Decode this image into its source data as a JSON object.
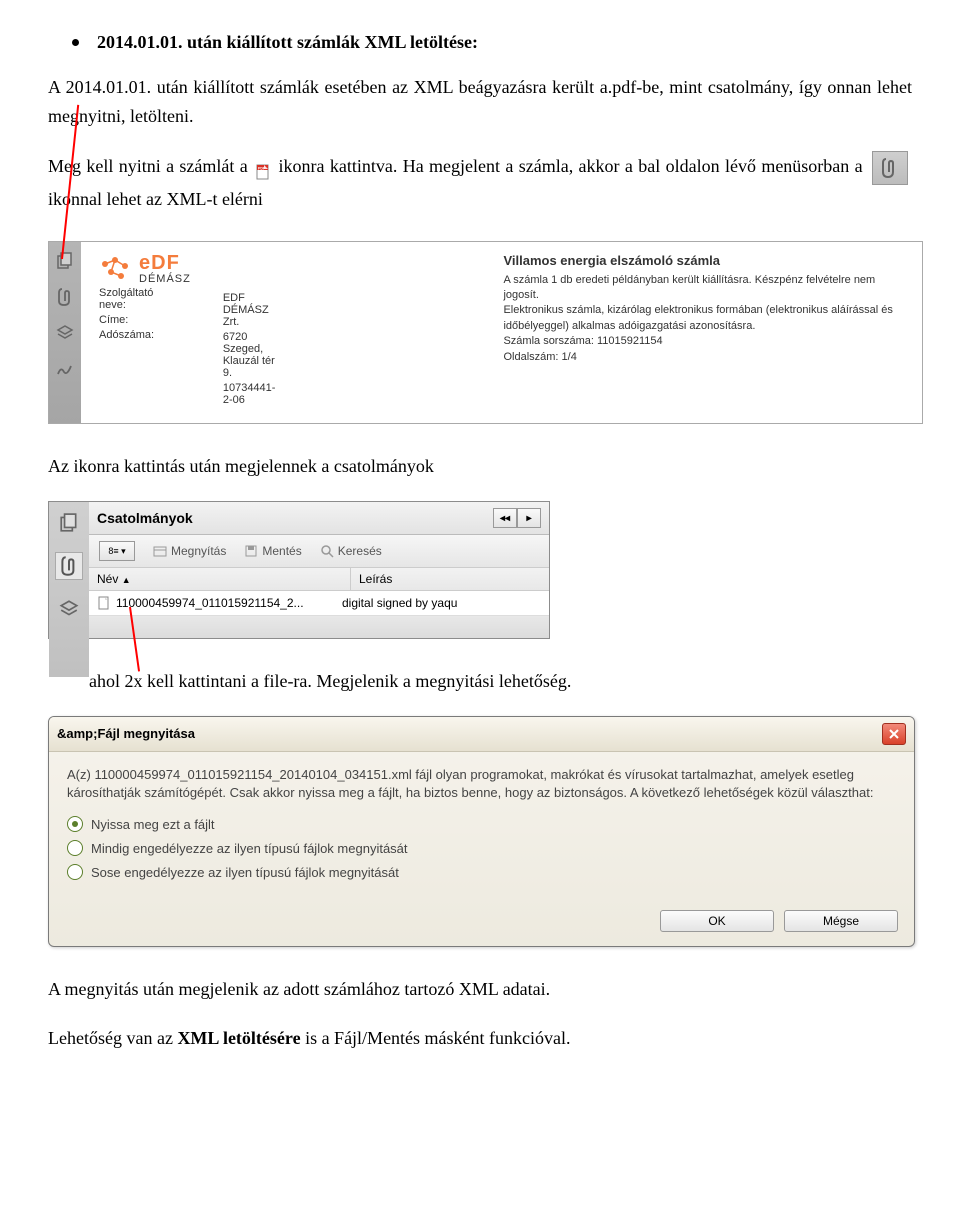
{
  "heading": "2014.01.01. után kiállított számlák XML letöltése:",
  "para1_a": "A 2014.01.01. után kiállított számlák esetében az XML beágyazásra került a.pdf-be, mint csatolmány, így onnan lehet megnyitni, letölteni.",
  "para2_a": "Meg kell nyitni a számlát a ",
  "para2_b": " ikonra kattintva. Ha megjelent a számla, akkor a bal oldalon lévő menüsorban a ",
  "para2_c": " ikonnal lehet az XML-t elérni",
  "ss1": {
    "provider_label": "Szolgáltató neve:",
    "address_label": "Címe:",
    "tax_label": "Adószáma:",
    "provider": "EDF DÉMÁSZ Zrt.",
    "address": "6720 Szeged, Klauzál tér 9.",
    "tax": "10734441-2-06",
    "logo_brand": "eDF",
    "logo_sub": "DÉMÁSZ",
    "title": "Villamos energia elszámoló számla",
    "line1": "A számla 1 db eredeti példányban került kiállításra.    Készpénz felvételre nem jogosít.",
    "line2": "Elektronikus számla, kizárólag elektronikus formában (elektronikus aláírással és időbélyeggel) alkalmas adóigazgatási azonosításra.",
    "line3": "Számla sorszáma: 11015921154",
    "line4": "Oldalszám: 1/4"
  },
  "para3": "Az ikonra kattintás után megjelennek a csatolmányok",
  "ss2": {
    "title": "Csatolmányok",
    "open": "Megnyítás",
    "save": "Mentés",
    "search": "Keresés",
    "col_name": "Név",
    "col_desc": "Leírás",
    "row_name": "110000459974_011015921154_2...",
    "row_desc": "digital signed by yaqu",
    "nav_prev": "◂◂",
    "nav_next": "▸",
    "dropdown": "8≡ ▾"
  },
  "para4": "ahol 2x kell kattintani a file-ra. Megjelenik a megnyitási lehetőség.",
  "dialog": {
    "title": "&amp;Fájl megnyitása",
    "body": "A(z) 110000459974_011015921154_20140104_034151.xml fájl olyan programokat, makrókat és vírusokat tartalmazhat, amelyek esetleg károsíthatják számítógépét. Csak akkor nyissa meg a fájlt, ha biztos benne, hogy az biztonságos. A következő lehetőségek közül választhat:",
    "opt1": "Nyissa meg ezt a fájlt",
    "opt2": "Mindig engedélyezze az ilyen típusú fájlok megnyitását",
    "opt3": "Sose engedélyezze az ilyen típusú fájlok megnyitását",
    "ok": "OK",
    "cancel": "Mégse"
  },
  "para5": "A megnyitás után megjelenik az adott számlához tartozó XML adatai.",
  "para6_a": "Lehetőség van az ",
  "para6_b": "XML letöltésére",
  "para6_c": " is a Fájl/Mentés másként funkcióval."
}
